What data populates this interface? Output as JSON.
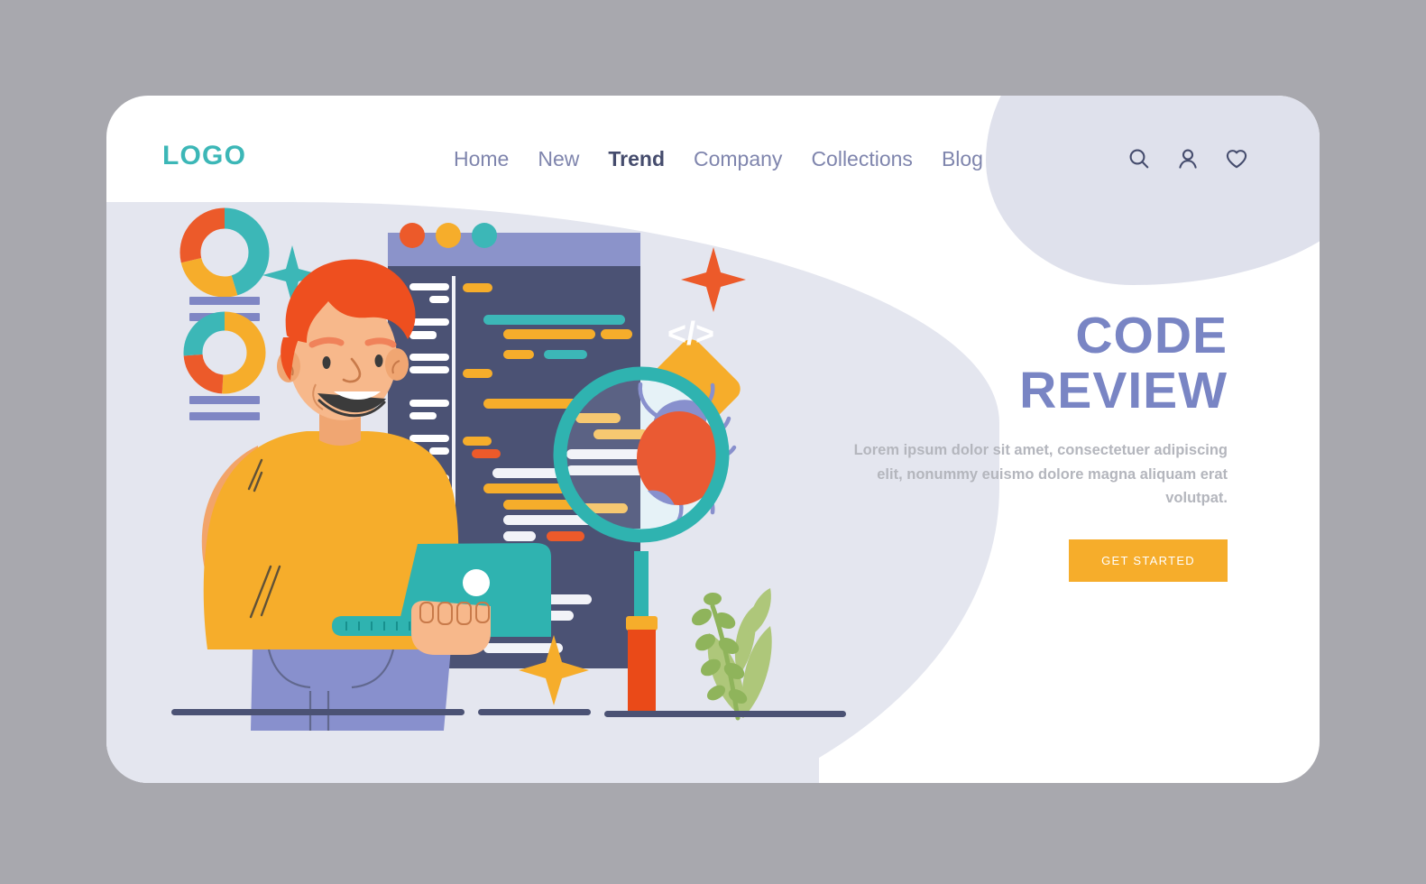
{
  "brand": {
    "logo_text": "LOGO",
    "logo_color": "#3cb7b7"
  },
  "header": {
    "nav_items": [
      {
        "label": "Home",
        "active": false
      },
      {
        "label": "New",
        "active": false
      },
      {
        "label": "Trend",
        "active": true
      },
      {
        "label": "Company",
        "active": false
      },
      {
        "label": "Collections",
        "active": false
      },
      {
        "label": "Blog",
        "active": false
      }
    ],
    "icons": [
      {
        "name": "search-icon",
        "label": "Search"
      },
      {
        "name": "user-icon",
        "label": "Account"
      },
      {
        "name": "heart-icon",
        "label": "Favorites"
      }
    ],
    "nav_color": "#7f85ad",
    "nav_active_color": "#454c6d",
    "icon_color": "#454c6d"
  },
  "hero": {
    "title_line_1": "CODE",
    "title_line_2": "REVIEW",
    "title_color": "#7985c4",
    "paragraph": "Lorem ipsum dolor sit amet, consectetuer adipiscing elit, nonummy euismo dolore magna aliquam erat volutpat.",
    "paragraph_color": "#b4b6bd",
    "cta_label": "GET STARTED",
    "cta_background": "#f6ad2b",
    "cta_text_color": "#ffffff"
  },
  "illustration": {
    "scene_name": "developer-reviewing-code",
    "background_blob_color": "#e4e6ef",
    "card_background": "#ffffff",
    "page_background": "#a8a8ae",
    "elements": [
      {
        "name": "donut-chart-top",
        "segments": [
          "teal",
          "amber",
          "orange-red"
        ]
      },
      {
        "name": "donut-chart-bottom",
        "segments": [
          "amber",
          "orange-red",
          "teal"
        ]
      },
      {
        "name": "stat-bars",
        "count": 4,
        "color": "#7f86c4"
      },
      {
        "name": "sparkle-teal",
        "color": "#3cb7b7"
      },
      {
        "name": "sparkle-orange",
        "color": "#ec5a2a"
      },
      {
        "name": "sparkle-amber",
        "color": "#f6ad2b"
      },
      {
        "name": "code-window",
        "titlebar_color": "#8b93ca",
        "body_color": "#4b5274"
      },
      {
        "name": "window-dot-red",
        "color": "#ec5a2a"
      },
      {
        "name": "window-dot-amber",
        "color": "#f6ad2b"
      },
      {
        "name": "window-dot-teal",
        "color": "#3cb7b7"
      },
      {
        "name": "code-badge-diamond",
        "glyph": "</>",
        "color": "#f6ad2b"
      },
      {
        "name": "developer-character",
        "shirt_color": "#f6ad2b",
        "hair_color": "#ee4f1f",
        "jeans_color": "#8890cd"
      },
      {
        "name": "laptop",
        "color": "#2fb3b0"
      },
      {
        "name": "magnifier",
        "ring_color": "#2fb3b0",
        "handle_color": "#ea4a18"
      },
      {
        "name": "bug",
        "body_color": "#ea5a33",
        "wing_color": "#8890cd"
      },
      {
        "name": "plant",
        "color": "#aec77a"
      },
      {
        "name": "ground-lines",
        "color": "#4b5274",
        "count": 3
      }
    ]
  },
  "colors": {
    "teal": "#3cb7b7",
    "periwinkle": "#7985c4",
    "amber": "#f6ad2b",
    "orange_red": "#ec5a2a",
    "slate": "#4b5274",
    "lavender_bg": "#e4e6ef"
  }
}
